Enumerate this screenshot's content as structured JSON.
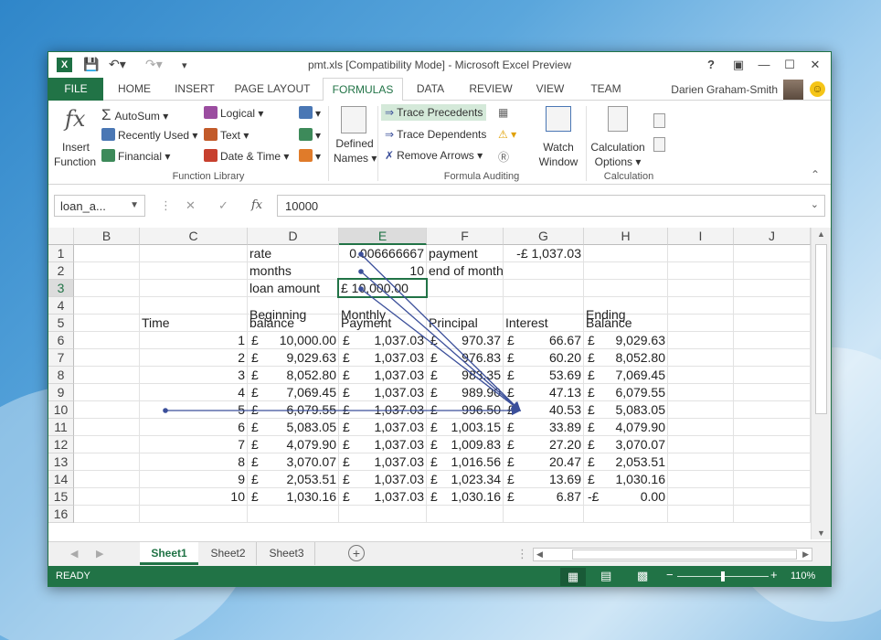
{
  "app": {
    "title": "pmt.xls  [Compatibility Mode] - Microsoft Excel Preview",
    "logo": "X",
    "user": "Darien Graham-Smith"
  },
  "tabs": [
    "FILE",
    "HOME",
    "INSERT",
    "PAGE LAYOUT",
    "FORMULAS",
    "DATA",
    "REVIEW",
    "VIEW",
    "TEAM"
  ],
  "ribbon": {
    "insert_function": [
      "Insert",
      "Function"
    ],
    "function_library": {
      "autosum": "AutoSum",
      "recently_used": "Recently Used",
      "financial": "Financial",
      "logical": "Logical",
      "text": "Text",
      "date_time": "Date & Time",
      "label": "Function Library"
    },
    "defined_names": [
      "Defined",
      "Names"
    ],
    "formula_auditing": {
      "trace_precedents": "Trace Precedents",
      "trace_dependents": "Trace Dependents",
      "remove_arrows": "Remove Arrows",
      "label": "Formula Auditing"
    },
    "watch_window": [
      "Watch",
      "Window"
    ],
    "calculation": {
      "options": [
        "Calculation",
        "Options"
      ],
      "label": "Calculation"
    }
  },
  "formula_bar": {
    "name_box": "loan_a...",
    "formula": "10000"
  },
  "columns": [
    "B",
    "C",
    "D",
    "E",
    "F",
    "G",
    "H",
    "I",
    "J"
  ],
  "rows": [
    "1",
    "2",
    "3",
    "4",
    "5",
    "6",
    "7",
    "8",
    "9",
    "10",
    "11",
    "12",
    "13",
    "14",
    "15",
    "16"
  ],
  "cells": {
    "D1": "rate",
    "E1": "0.006666667",
    "F1": "payment",
    "G1": "-£   1,037.03",
    "D2": "months",
    "E2": "10",
    "F2": "end of month",
    "D3": "loan amount",
    "E3": "£  10,000.00",
    "D4a": "Beginning",
    "E4a": "Monthly",
    "H4a": "Ending",
    "C5": "Time",
    "D5": "balance",
    "E5": "Payment",
    "F5": "Principal",
    "G5": "Interest",
    "H5": "Balance"
  },
  "table": [
    {
      "t": "1",
      "beg": "10,000.00",
      "pay": "1,037.03",
      "prin": "970.37",
      "int": "66.67",
      "end": "9,029.63"
    },
    {
      "t": "2",
      "beg": "9,029.63",
      "pay": "1,037.03",
      "prin": "976.83",
      "int": "60.20",
      "end": "8,052.80"
    },
    {
      "t": "3",
      "beg": "8,052.80",
      "pay": "1,037.03",
      "prin": "983.35",
      "int": "53.69",
      "end": "7,069.45"
    },
    {
      "t": "4",
      "beg": "7,069.45",
      "pay": "1,037.03",
      "prin": "989.90",
      "int": "47.13",
      "end": "6,079.55"
    },
    {
      "t": "5",
      "beg": "6,079.55",
      "pay": "1,037.03",
      "prin": "996.50",
      "int": "40.53",
      "end": "5,083.05"
    },
    {
      "t": "6",
      "beg": "5,083.05",
      "pay": "1,037.03",
      "prin": "1,003.15",
      "int": "33.89",
      "end": "4,079.90"
    },
    {
      "t": "7",
      "beg": "4,079.90",
      "pay": "1,037.03",
      "prin": "1,009.83",
      "int": "27.20",
      "end": "3,070.07"
    },
    {
      "t": "8",
      "beg": "3,070.07",
      "pay": "1,037.03",
      "prin": "1,016.56",
      "int": "20.47",
      "end": "2,053.51"
    },
    {
      "t": "9",
      "beg": "2,053.51",
      "pay": "1,037.03",
      "prin": "1,023.34",
      "int": "13.69",
      "end": "1,030.16"
    },
    {
      "t": "10",
      "beg": "1,030.16",
      "pay": "1,037.03",
      "prin": "1,030.16",
      "int": "6.87",
      "end": "0.00"
    }
  ],
  "currency": "£",
  "last_end_prefix": "-£",
  "sheets": [
    "Sheet1",
    "Sheet2",
    "Sheet3"
  ],
  "status": {
    "mode": "READY",
    "zoom": "110%"
  },
  "colors": {
    "accent": "#217346",
    "trace_arrow": "#3b4f9a"
  }
}
